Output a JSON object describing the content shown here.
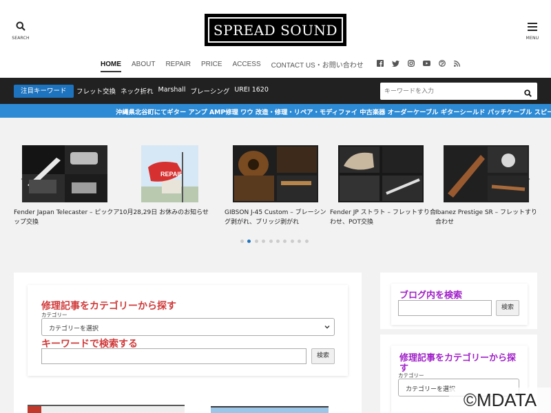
{
  "header": {
    "search_label": "SEARCH",
    "menu_label": "MENU",
    "logo_text": "SPREAD SOUND"
  },
  "nav": {
    "items": [
      "HOME",
      "ABOUT",
      "REPAIR",
      "PRICE",
      "ACCESS",
      "CONTACT US・お問い合わせ"
    ],
    "social_icons": [
      "facebook-icon",
      "twitter-icon",
      "instagram-icon",
      "youtube-icon",
      "pinterest-icon",
      "rss-icon"
    ]
  },
  "keyword_bar": {
    "badge": "注目キーワード",
    "links": [
      "フレット交換",
      "ネック折れ",
      "Marshall",
      "ブレーシング",
      "UREI 1620"
    ],
    "search_placeholder": "キーワードを入力"
  },
  "ticker": {
    "text": "沖縄県北谷町にてギター アンプ AMP修理 ワウ 改造・修理・リペア・モディファイ 中古楽器 オーダーケーブル ギターシールド パッチケーブル スピーカ"
  },
  "slider": {
    "slides": [
      {
        "caption": "Fender Japan Telecaster – ピックアップ交換"
      },
      {
        "caption": "10月28,29日 お休みのお知らせ",
        "thumb_text": "REPAIR"
      },
      {
        "caption": "GIBSON J-45 Custom – ブレーシング剥がれ、ブリッジ剥がれ"
      },
      {
        "caption": "Fender JP ストラト – フレットすり合わせ、POT交換"
      },
      {
        "caption": "Ibanez Prestige SR – フレットすり合わせ"
      }
    ],
    "page_count": 10,
    "active_page": 2,
    "prev_icon": "chevron-left-icon",
    "next_icon": "chevron-right-icon"
  },
  "main_widget": {
    "category_heading": "修理記事をカテゴリーから探す",
    "category_label": "カテゴリー",
    "category_select": "カテゴリーを選択",
    "keyword_heading": "キーワードで検索する",
    "search_button": "検索"
  },
  "sidebar": {
    "blog_search_heading": "ブログ内を検索",
    "blog_search_button": "検索",
    "category_heading": "修理記事をカテゴリーから探す",
    "category_label": "カテゴリー",
    "category_select": "カテゴリーを選択"
  },
  "watermark": "©MDATA",
  "colors": {
    "accent_blue": "#1e73be",
    "ticker_blue": "#2d8ad4",
    "heading_red": "#d03a3a",
    "heading_purple": "#a020c8",
    "bar_dark": "#212121"
  }
}
